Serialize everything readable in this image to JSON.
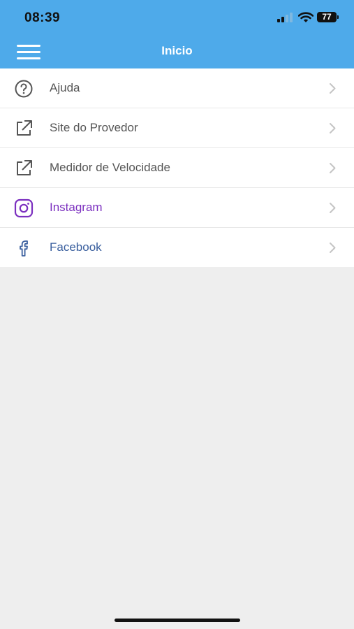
{
  "status_bar": {
    "time": "08:39",
    "battery_level": "77"
  },
  "header": {
    "title": "Inicio",
    "background_color": "#4eaaea"
  },
  "menu": {
    "items": [
      {
        "label": "Ajuda",
        "icon": "help-circle-icon",
        "color": "#555555"
      },
      {
        "label": "Site do Provedor",
        "icon": "external-link-icon",
        "color": "#555555"
      },
      {
        "label": "Medidor de Velocidade",
        "icon": "external-link-icon",
        "color": "#555555"
      },
      {
        "label": "Instagram",
        "icon": "instagram-icon",
        "color": "#7b2fbf"
      },
      {
        "label": "Facebook",
        "icon": "facebook-icon",
        "color": "#3a5f9e"
      }
    ]
  }
}
